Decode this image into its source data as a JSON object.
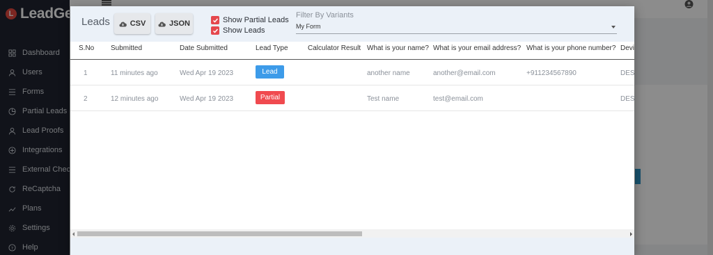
{
  "app": {
    "brand_name": "LeadGen",
    "brand_initial": "L"
  },
  "sidebar": {
    "items": [
      {
        "label": "Dashboard",
        "icon": "grid-icon"
      },
      {
        "label": "Users",
        "icon": "user-icon"
      },
      {
        "label": "Forms",
        "icon": "list-icon"
      },
      {
        "label": "Partial Leads",
        "icon": "partial-icon"
      },
      {
        "label": "Lead Proofs",
        "icon": "user-icon"
      },
      {
        "label": "Integrations",
        "icon": "plug-icon"
      },
      {
        "label": "External Checko",
        "icon": "list-icon"
      },
      {
        "label": "ReCaptcha",
        "icon": "refresh-icon"
      },
      {
        "label": "Plans",
        "icon": "trend-icon"
      },
      {
        "label": "Settings",
        "icon": "gear-icon"
      },
      {
        "label": "Help",
        "icon": "help-icon"
      }
    ]
  },
  "modal": {
    "title": "Leads",
    "csv_label": "CSV",
    "json_label": "JSON",
    "show_partial_label": "Show Partial Leads",
    "show_leads_label": "Show Leads",
    "filter_label": "Filter By Variants",
    "filter_value": "My Form",
    "columns": [
      "S.No",
      "Submitted",
      "Date Submitted",
      "Lead Type",
      "Calculator Result",
      "What is your name?",
      "What is your email address?",
      "What is your phone number?",
      "Devi"
    ],
    "rows": [
      {
        "sno": "1",
        "submitted": "11 minutes ago",
        "date": "Wed Apr 19 2023",
        "type": "Lead",
        "calc": "",
        "name": "another name",
        "email": "another@email.com",
        "phone": "+911234567890",
        "device": "DES"
      },
      {
        "sno": "2",
        "submitted": "12 minutes ago",
        "date": "Wed Apr 19 2023",
        "type": "Partial",
        "calc": "",
        "name": "Test name",
        "email": "test@email.com",
        "phone": "",
        "device": "DES"
      }
    ]
  },
  "colors": {
    "lead_badge": "#3d9be9",
    "partial_badge": "#f04a4f",
    "checkbox": "#e5484d",
    "header_bg": "#ebf1f8"
  }
}
